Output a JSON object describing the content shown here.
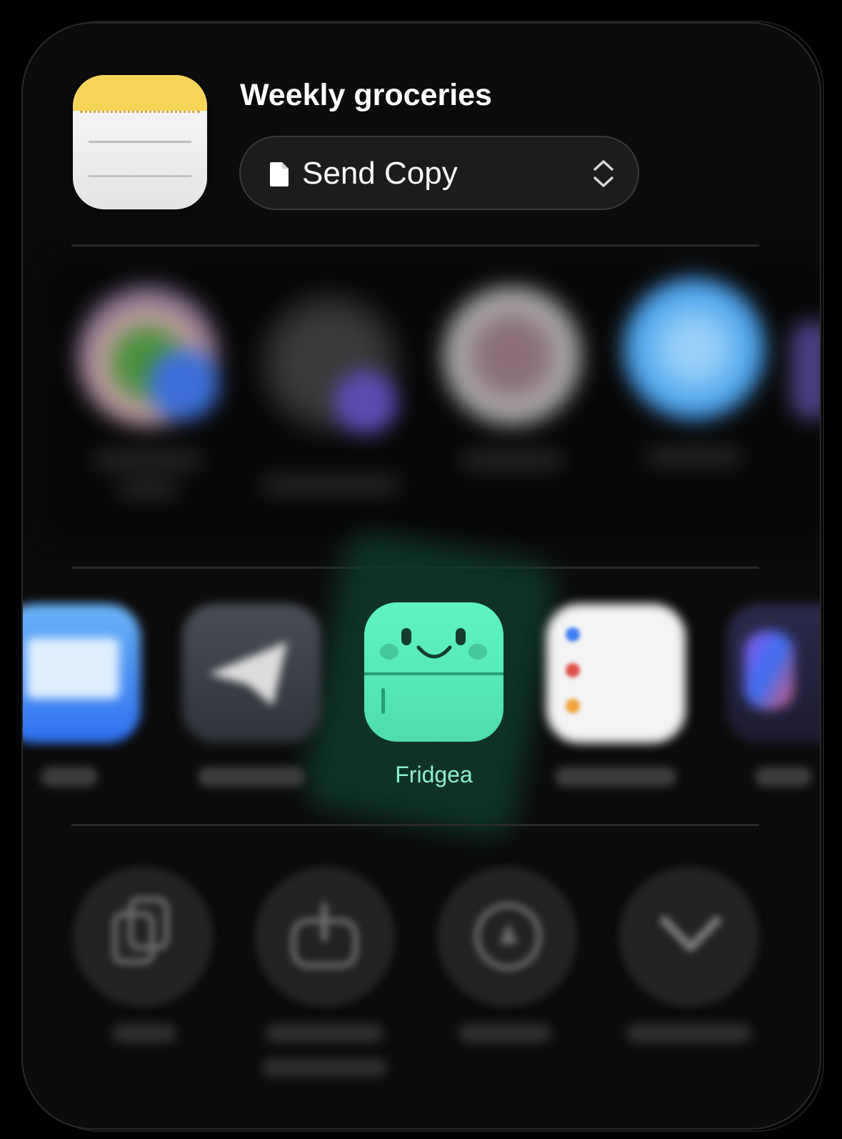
{
  "note": {
    "title": "Weekly groceries",
    "app_icon": "notes-icon"
  },
  "share_mode": {
    "label": "Send Copy",
    "icon": "document-icon",
    "chevron": "up-down-chevron-icon"
  },
  "people": [
    {
      "name": "",
      "colors": [
        "#c8a0a0",
        "#4a8f3e",
        "#3e6fd8"
      ]
    },
    {
      "name": "",
      "colors": [
        "#3a3a3a",
        "#5a4bb0"
      ]
    },
    {
      "name": "",
      "colors": [
        "#9a9a9a",
        "#8a6f78"
      ]
    },
    {
      "name": "",
      "colors": [
        "#5aaef0",
        "#3d8ee0"
      ]
    }
  ],
  "apps": [
    {
      "name": "Mail",
      "icon": "mail-icon",
      "color": "#3d86ef"
    },
    {
      "name": "Telegram",
      "icon": "telegram-icon",
      "color": "#3a3f47"
    },
    {
      "name": "Fridgea",
      "icon": "fridgea-icon",
      "color": "#5cefc0"
    },
    {
      "name": "Reminders",
      "icon": "reminders-icon",
      "color": "#f4f4f4"
    },
    {
      "name": "Journal",
      "icon": "journal-icon",
      "color": "#2c2a4a"
    }
  ],
  "actions": [
    {
      "name": "Copy",
      "icon": "copy-icon"
    },
    {
      "name": "Export as Markdown",
      "icon": "export-icon"
    },
    {
      "name": "Markup",
      "icon": "markup-icon"
    },
    {
      "name": "View More",
      "icon": "chevron-down-icon"
    }
  ]
}
